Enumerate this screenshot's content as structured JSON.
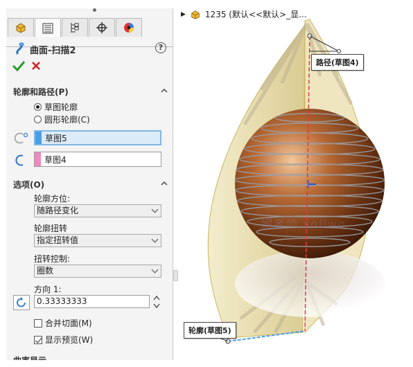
{
  "feature": {
    "title": "曲面-扫描2"
  },
  "help_glyph": "?",
  "profile_path": {
    "heading": "轮廓和路径(P)",
    "radio_sketch": "草图轮廓",
    "radio_circle": "圆形轮廓(C)",
    "profile_value": "草图5",
    "path_value": "草图4",
    "profile_color": "#4a9ee8",
    "path_color": "#f08ac0"
  },
  "options": {
    "heading": "选项(O)",
    "orientation_label": "轮廓方位:",
    "orientation_value": "随路径变化",
    "twist_label": "轮廓扭转",
    "twist_value": "指定扭转值",
    "twist_control_label": "扭转控制:",
    "twist_control_value": "圈数",
    "direction_label": "方向 1:",
    "direction_value": "0.33333333",
    "merge_label": "合并切面(M)",
    "preview_label": "显示预览(W)"
  },
  "next_section": "曲率显示",
  "viewport": {
    "tree_label": "1235 (默认<<默认>_显...",
    "path_callout": "路径(草图4)",
    "profile_callout": "轮廓(草图5)",
    "watermark": "妮老师 soliwo"
  },
  "icons": [
    "feature-manager-icon",
    "property-manager-icon",
    "configuration-icon",
    "origin-target-icon",
    "appearance-icon",
    "sweep-icon",
    "ok-check-icon",
    "cancel-x-icon",
    "collapse-arrow-icon",
    "direction-icon",
    "part-icon"
  ]
}
